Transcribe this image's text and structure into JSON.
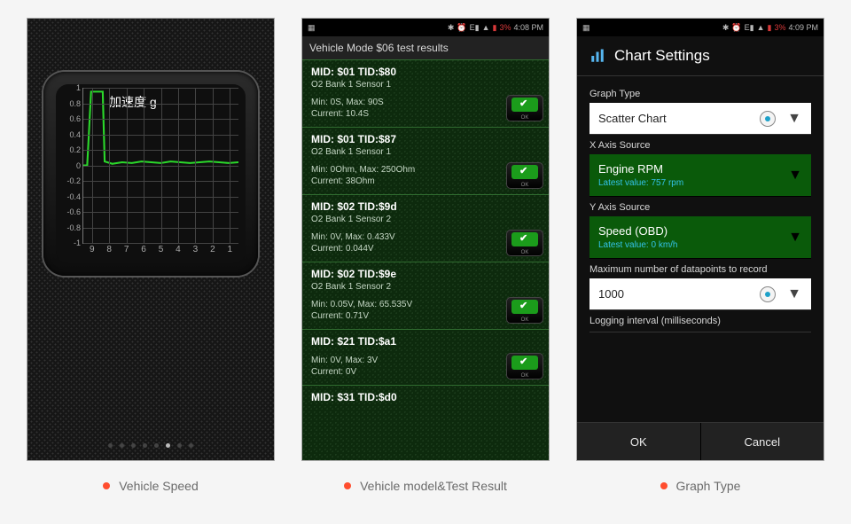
{
  "statusbar": {
    "battery": "3%",
    "time_p2": "4:08 PM",
    "time_p3": "4:09 PM"
  },
  "captions": {
    "p1": "Vehicle Speed",
    "p2": "Vehicle model&Test Result",
    "p3": "Graph Type"
  },
  "phone1": {
    "gauge_title": "加速度 g",
    "y_ticks": [
      "1",
      "0.8",
      "0.6",
      "0.4",
      "0.2",
      "0",
      "-0.2",
      "-0.4",
      "-0.6",
      "-0.8",
      "-1"
    ],
    "x_ticks": [
      "9",
      "8",
      "7",
      "6",
      "5",
      "4",
      "3",
      "2",
      "1"
    ]
  },
  "chart_data": {
    "type": "line",
    "title": "加速度 g",
    "xlabel": "",
    "ylabel": "",
    "ylim": [
      -1,
      1
    ],
    "x": [
      9,
      8.8,
      8.6,
      8.4,
      8,
      7.9,
      7.5,
      7,
      6.5,
      6,
      5.5,
      5,
      4.5,
      4,
      3.5,
      3,
      2.5,
      2,
      1.5,
      1
    ],
    "values": [
      0,
      0,
      0.95,
      0.95,
      0.95,
      0.05,
      0.02,
      0.04,
      0.03,
      0.05,
      0.04,
      0.03,
      0.05,
      0.04,
      0.03,
      0.04,
      0.05,
      0.04,
      0.03,
      0.04
    ]
  },
  "phone2": {
    "title": "Vehicle Mode $06 test results",
    "ok_label": "OK",
    "items": [
      {
        "mid": "MID: $01 TID:$80",
        "sub": "O2 Bank 1 Sensor 1",
        "values": "Min: 0S, Max: 90S\nCurrent: 10.4S"
      },
      {
        "mid": "MID: $01 TID:$87",
        "sub": "O2 Bank 1 Sensor 1",
        "values": "Min: 0Ohm, Max: 250Ohm\nCurrent: 38Ohm"
      },
      {
        "mid": "MID: $02 TID:$9d",
        "sub": "O2 Bank 1 Sensor 2",
        "values": "Min: 0V, Max: 0.433V\nCurrent: 0.044V"
      },
      {
        "mid": "MID: $02 TID:$9e",
        "sub": "O2 Bank 1 Sensor 2",
        "values": "Min: 0.05V, Max: 65.535V\nCurrent: 0.71V"
      },
      {
        "mid": "MID: $21 TID:$a1",
        "sub": "",
        "values": "Min: 0V, Max: 3V\nCurrent: 0V"
      },
      {
        "mid": "MID: $31 TID:$d0",
        "sub": "",
        "values": ""
      }
    ]
  },
  "phone3": {
    "title": "Chart Settings",
    "graph_type_label": "Graph Type",
    "graph_type_value": "Scatter Chart",
    "x_source_label": "X Axis Source",
    "x_source_value": "Engine RPM",
    "x_source_latest": "Latest value: 757 rpm",
    "y_source_label": "Y Axis Source",
    "y_source_value": "Speed (OBD)",
    "y_source_latest": "Latest value: 0 km/h",
    "max_points_label": "Maximum number of datapoints to record",
    "max_points_value": "1000",
    "interval_label": "Logging interval (milliseconds)",
    "ok": "OK",
    "cancel": "Cancel"
  }
}
